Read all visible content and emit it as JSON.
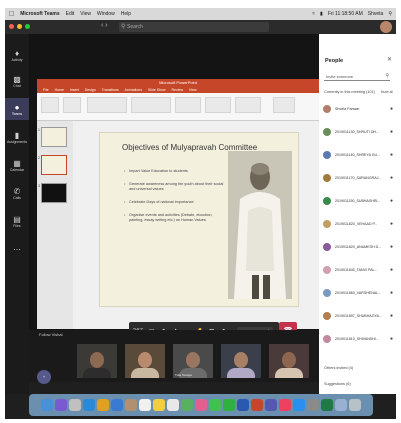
{
  "menubar": {
    "app": "Microsoft Teams",
    "items": [
      "Edit",
      "View",
      "Window",
      "Help"
    ],
    "clock": "Fri 11:18:50 AM",
    "user": "Shveta"
  },
  "titlebar": {
    "search_placeholder": "Search"
  },
  "rail": {
    "items": [
      {
        "label": "Activity",
        "icon": "bell-icon"
      },
      {
        "label": "Chat",
        "icon": "chat-icon"
      },
      {
        "label": "Teams",
        "icon": "teams-icon"
      },
      {
        "label": "Assignments",
        "icon": "assignment-icon"
      },
      {
        "label": "Calendar",
        "icon": "calendar-icon"
      },
      {
        "label": "Calls",
        "icon": "phone-icon"
      },
      {
        "label": "Files",
        "icon": "files-icon"
      }
    ],
    "active_index": 2
  },
  "ppt": {
    "window_title": "Microsoft PowerPoint",
    "tabs": [
      "File",
      "Home",
      "Insert",
      "Design",
      "Transitions",
      "Animations",
      "Slide Show",
      "Review",
      "View"
    ]
  },
  "slide": {
    "title": "Objectives of Mulyapravah Committee",
    "bullets": [
      "Impart Value Education to students",
      "Generate awareness among the youth about their social and universal values",
      "Celebrate Days of national importance",
      "Organise events and activities (Debate, elocution, painting, essay writing etc.) on Human Values"
    ]
  },
  "controls": {
    "time": "2:57",
    "report_label": "Report control"
  },
  "strip": {
    "label": "Follow Vishal",
    "tiles": [
      "",
      "",
      "Tulsi Teraiya",
      "",
      ""
    ]
  },
  "people": {
    "title": "People",
    "search_placeholder": "Invite someone",
    "in_meeting": "Currently in this meeting (101)",
    "mute_all": "Mute all",
    "list": [
      "Shveta Panwar",
      "2019011130_SHRUTI DH...",
      "2019011140_SHREYA GU...",
      "2019011170_SARANGRAJ...",
      "2019011150_SUBHASHRI...",
      "2019011820_VEHAAD P...",
      "2019011820_ANUMESH D...",
      "2019011840_TANVI PAL...",
      "2019011860_VARSHENAL...",
      "2019011897_SHUBHAGYA...",
      "2019011810_SHIVANSHI..."
    ],
    "others": "Others invited (4)",
    "suggestions": "Suggestions (6)"
  }
}
